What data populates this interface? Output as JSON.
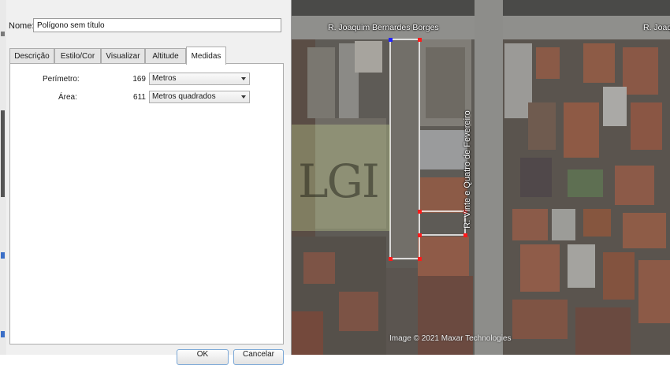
{
  "dialog": {
    "name_label": "Nome:",
    "name_value": "Polígono sem título",
    "tabs": [
      {
        "label": "Descrição"
      },
      {
        "label": "Estilo/Cor"
      },
      {
        "label": "Visualizar"
      },
      {
        "label": "Altitude"
      },
      {
        "label": "Medidas",
        "active": true
      }
    ],
    "measures": {
      "perimeter_label": "Perímetro:",
      "perimeter_value": "169",
      "perimeter_unit": "Metros",
      "area_label": "Área:",
      "area_value": "611",
      "area_unit": "Metros quadrados"
    },
    "buttons": {
      "ok_label": "OK",
      "cancel_label": "Cancelar"
    }
  },
  "map": {
    "street_top": "R. Joaquim Bernardes Borges",
    "street_top_right": "R. Joaq",
    "street_vertical": "R. Vinte e Quatro de Fevereiro",
    "copyright": "Image © 2021 Maxar Technologies",
    "watermark": "LGI",
    "polygon_color": "#ffffff",
    "vertex_color": "#ff1a1a",
    "selected_vertex_color": "#2020ff"
  }
}
